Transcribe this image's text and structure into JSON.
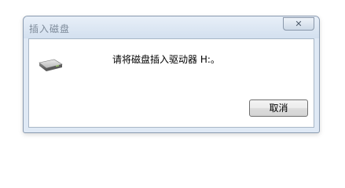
{
  "dialog": {
    "title": "插入磁盘",
    "close_glyph": "✕",
    "message": "请将磁盘插入驱动器 H:。",
    "cancel_label": "取消",
    "icon": "removable-drive-icon"
  }
}
